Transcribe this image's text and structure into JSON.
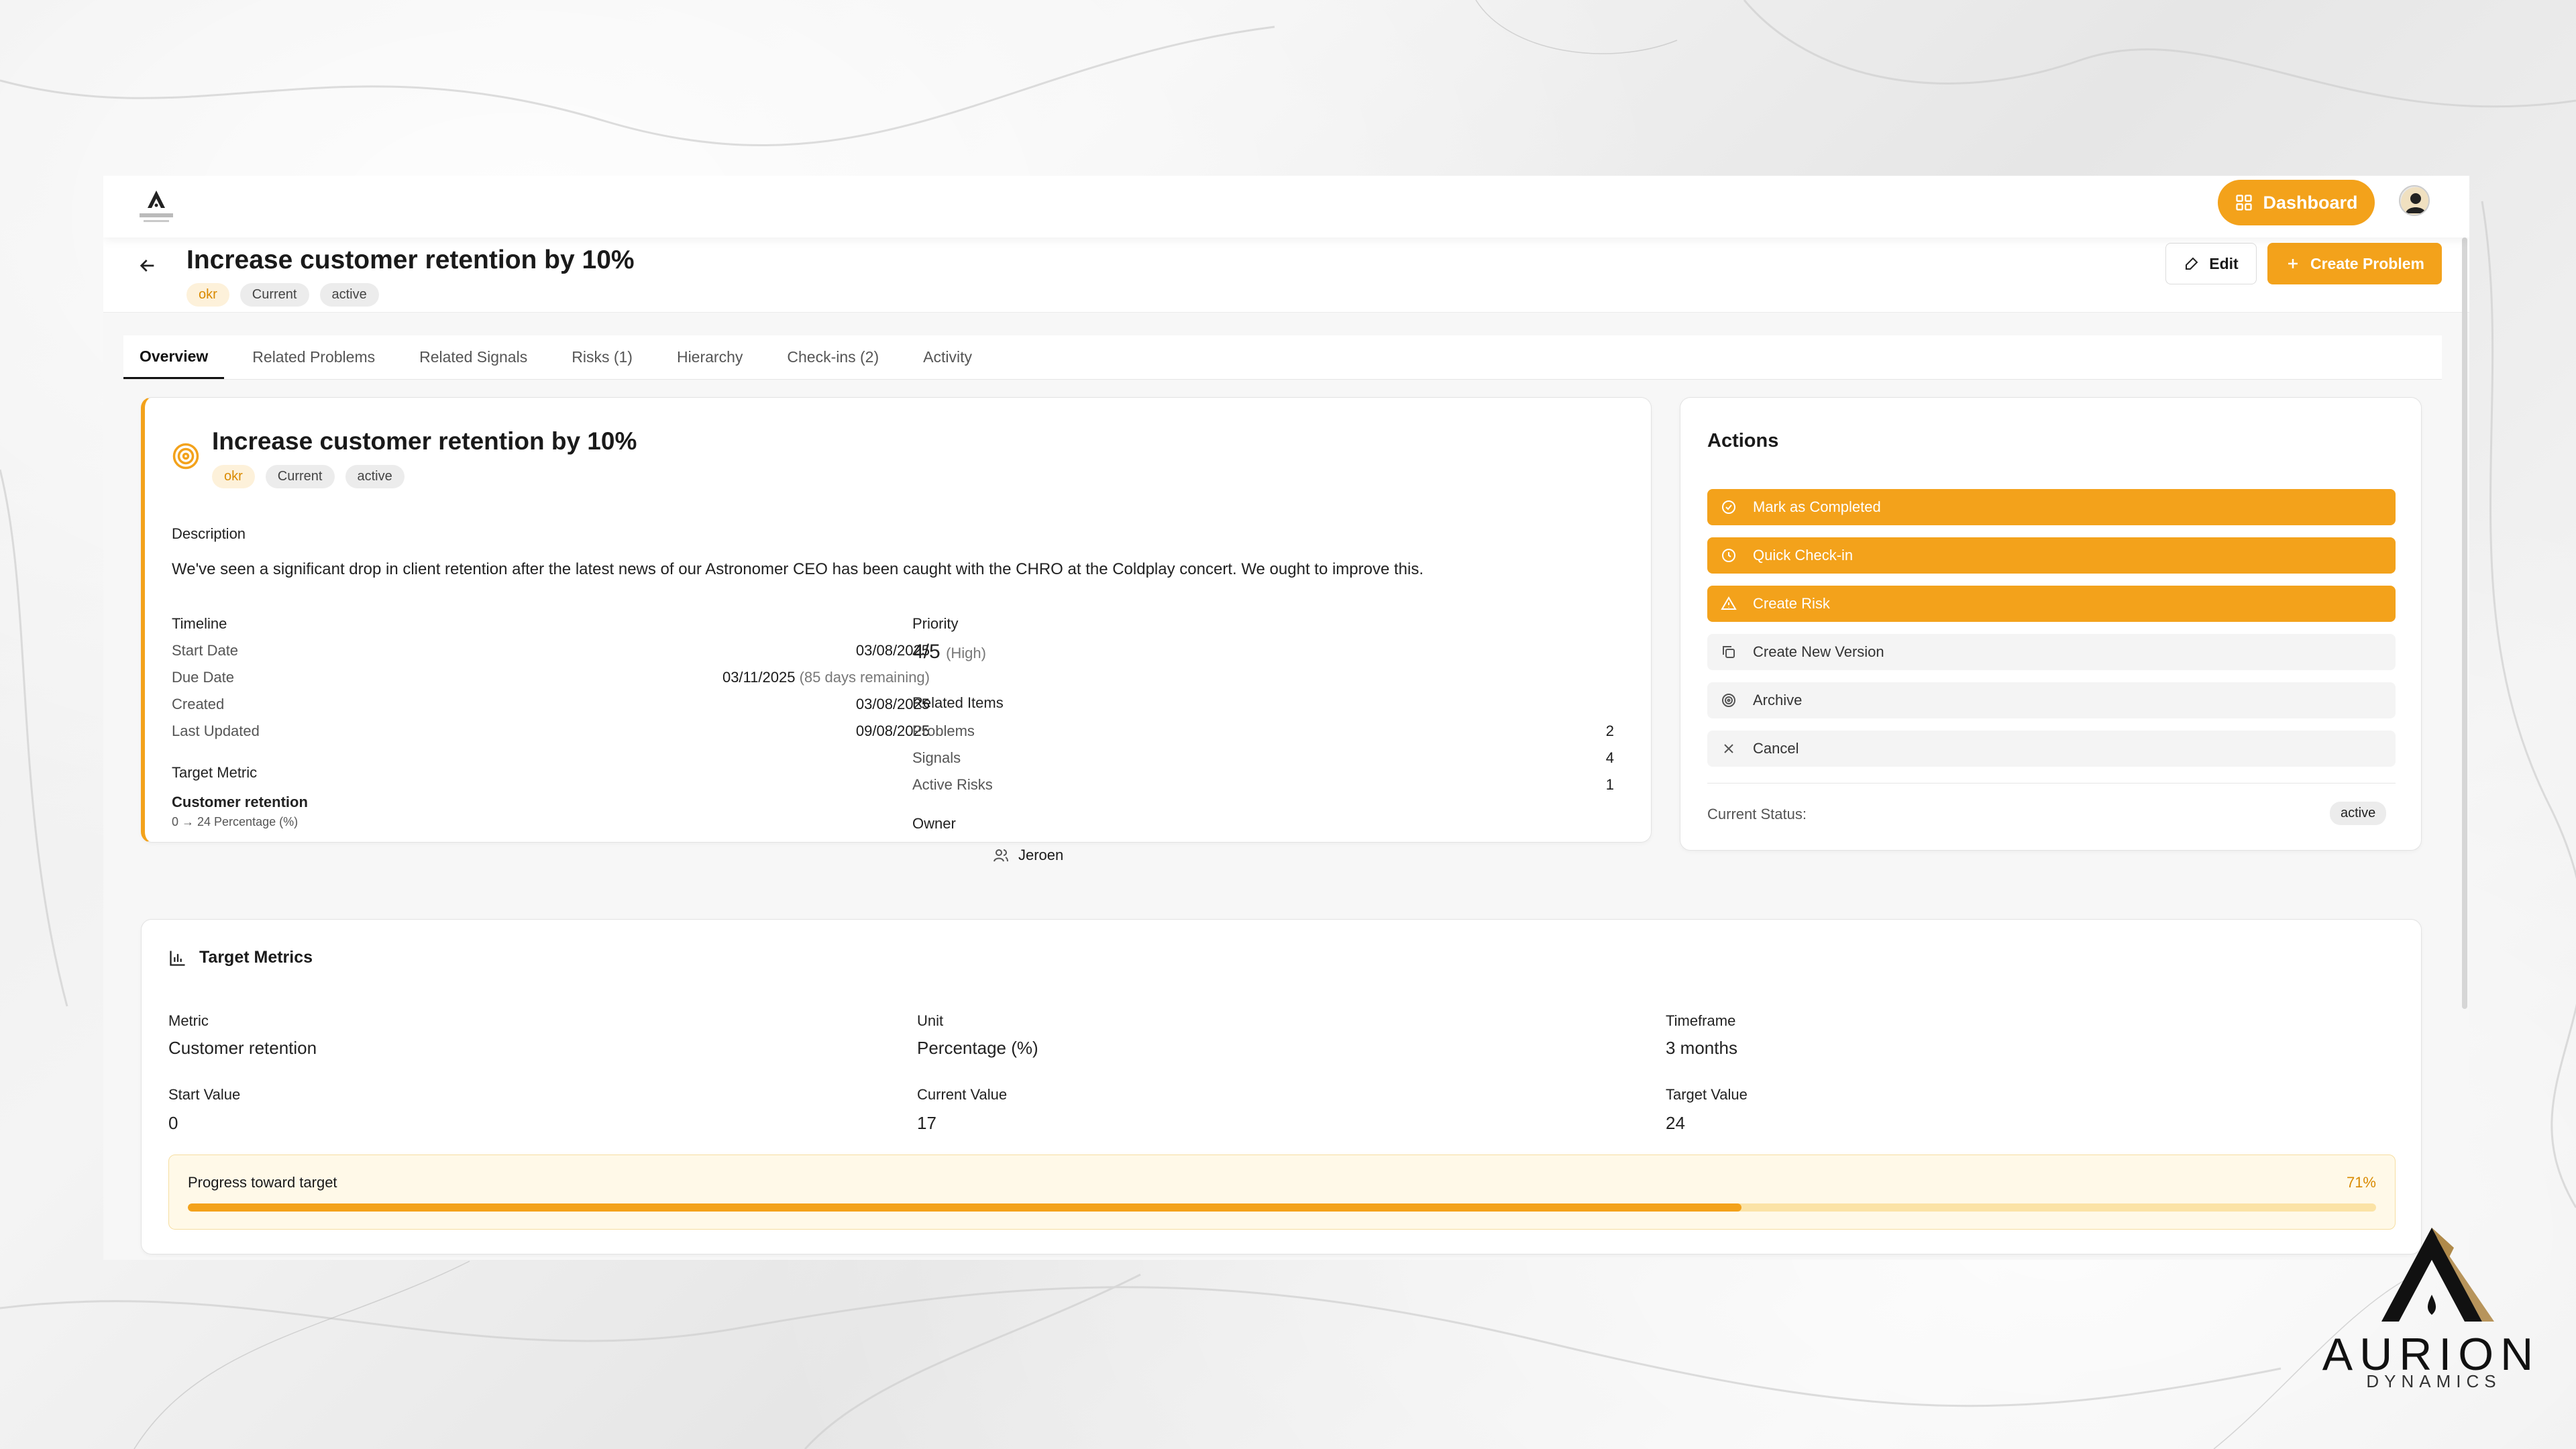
{
  "topbar": {
    "dashboard_label": "Dashboard"
  },
  "header": {
    "title": "Increase customer retention by 10%",
    "badges": [
      "okr",
      "Current",
      "active"
    ],
    "edit_label": "Edit",
    "create_problem_label": "Create Problem"
  },
  "tabs": [
    "Overview",
    "Related Problems",
    "Related Signals",
    "Risks (1)",
    "Hierarchy",
    "Check-ins (2)",
    "Activity"
  ],
  "overview": {
    "title": "Increase customer retention by 10%",
    "badges": [
      "okr",
      "Current",
      "active"
    ],
    "description_label": "Description",
    "description": "We've seen a significant drop in client retention after the latest news of our Astronomer CEO has been caught with the CHRO at the Coldplay concert. We ought to improve this.",
    "timeline_label": "Timeline",
    "timeline": [
      {
        "label": "Start Date",
        "value": "03/08/2025",
        "extra": ""
      },
      {
        "label": "Due Date",
        "value": "03/11/2025",
        "extra": "(85 days remaining)"
      },
      {
        "label": "Created",
        "value": "03/08/2025",
        "extra": ""
      },
      {
        "label": "Last Updated",
        "value": "09/08/2025",
        "extra": ""
      }
    ],
    "target_metric_label": "Target Metric",
    "target_metric_name": "Customer retention",
    "target_metric_range": "0 → 24 Percentage (%)",
    "priority_label": "Priority",
    "priority_value": "4/5",
    "priority_level": "(High)",
    "related_items_label": "Related Items",
    "related_items": [
      {
        "label": "Problems",
        "value": "2"
      },
      {
        "label": "Signals",
        "value": "4"
      },
      {
        "label": "Active Risks",
        "value": "1"
      }
    ],
    "owner_label": "Owner",
    "owner_name": "Jeroen"
  },
  "actions": {
    "title": "Actions",
    "buttons": [
      {
        "label": "Mark as Completed",
        "icon": "check-circle-icon",
        "style": "orange"
      },
      {
        "label": "Quick Check-in",
        "icon": "clock-icon",
        "style": "orange"
      },
      {
        "label": "Create Risk",
        "icon": "warning-icon",
        "style": "orange"
      },
      {
        "label": "Create New Version",
        "icon": "copy-icon",
        "style": "gray"
      },
      {
        "label": "Archive",
        "icon": "archive-icon",
        "style": "gray"
      },
      {
        "label": "Cancel",
        "icon": "close-icon",
        "style": "gray"
      }
    ],
    "current_status_label": "Current Status:",
    "current_status": "active"
  },
  "metrics": {
    "title": "Target Metrics",
    "metric_label": "Metric",
    "metric_value": "Customer retention",
    "unit_label": "Unit",
    "unit_value": "Percentage (%)",
    "timeframe_label": "Timeframe",
    "timeframe_value": "3 months",
    "start_label": "Start Value",
    "start_value": "0",
    "current_label": "Current Value",
    "current_value": "17",
    "target_label": "Target Value",
    "target_value": "24",
    "progress_label": "Progress toward target",
    "progress_pct": "71%",
    "progress_fraction": 0.71
  },
  "brand": {
    "name": "AURION",
    "sub": "DYNAMICS"
  },
  "colors": {
    "accent": "#f3a21b",
    "accent_light": "#fdf1da"
  }
}
